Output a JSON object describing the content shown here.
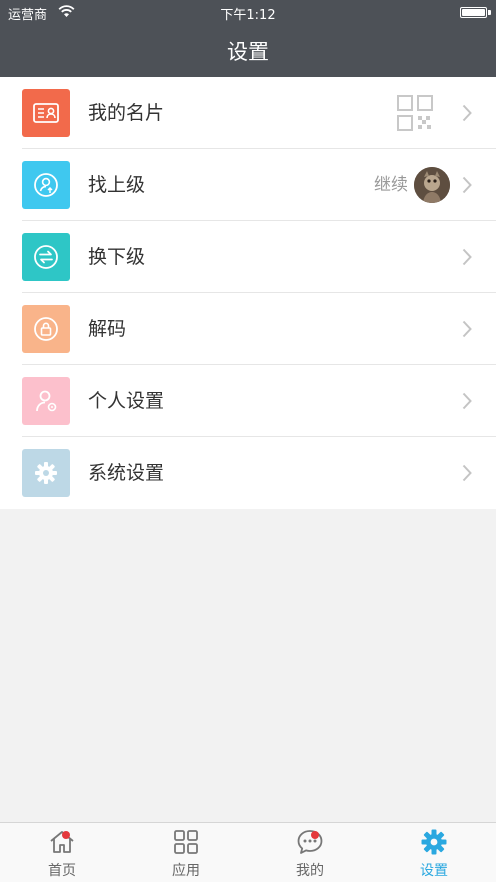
{
  "status_bar": {
    "carrier": "运营商",
    "time": "下午1:12"
  },
  "nav": {
    "title": "设置"
  },
  "rows": [
    {
      "label": "我的名片",
      "icon": "business-card-icon",
      "color": "#f26a4b"
    },
    {
      "label": "找上级",
      "icon": "user-up-icon",
      "color": "#3fc8ef",
      "value": "继续"
    },
    {
      "label": "换下级",
      "icon": "swap-icon",
      "color": "#2ec6c6"
    },
    {
      "label": "解码",
      "icon": "lock-icon",
      "color": "#f9b48a"
    },
    {
      "label": "个人设置",
      "icon": "user-settings-icon",
      "color": "#fcc0cc"
    },
    {
      "label": "系统设置",
      "icon": "gear-icon",
      "color": "#bdd8e6"
    }
  ],
  "tabs": [
    {
      "label": "首页",
      "icon": "home-icon",
      "badge": true
    },
    {
      "label": "应用",
      "icon": "grid-icon",
      "badge": false
    },
    {
      "label": "我的",
      "icon": "chat-icon",
      "badge": true
    },
    {
      "label": "设置",
      "icon": "gear-icon",
      "badge": false,
      "active": true
    }
  ],
  "colors": {
    "nav_bg": "#4d5157",
    "accent": "#2aa8e0",
    "badge": "#e4393c"
  }
}
